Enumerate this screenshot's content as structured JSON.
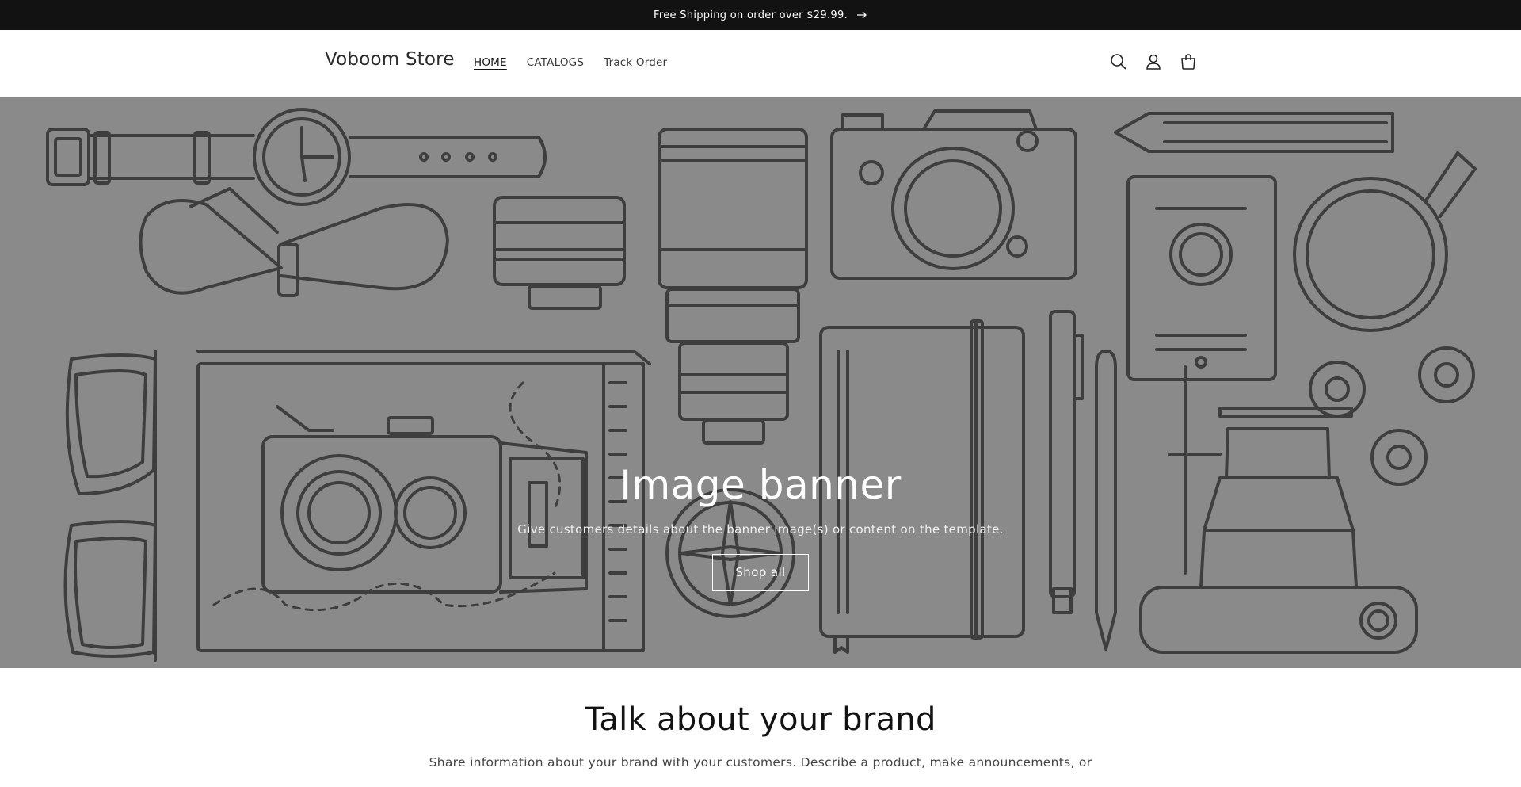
{
  "announcement": {
    "text": "Free Shipping on order over $29.99.",
    "icon": "arrow-right-icon"
  },
  "header": {
    "logo": "Voboom Store",
    "nav": [
      {
        "label": "HOME",
        "active": true
      },
      {
        "label": "CATALOGS",
        "active": false
      },
      {
        "label": "Track Order",
        "active": false
      }
    ],
    "icons": [
      "search-icon",
      "account-icon",
      "cart-icon"
    ]
  },
  "banner": {
    "title": "Image banner",
    "text": "Give customers details about the banner image(s) or content on the template.",
    "button": "Shop all"
  },
  "brand": {
    "title": "Talk about your brand",
    "text": "Share information about your brand with your customers. Describe a product, make announcements, or"
  },
  "colors": {
    "announcement_bg": "#121212",
    "banner_bg": "#8a8a8a",
    "line_art": "#3e3e3e"
  }
}
